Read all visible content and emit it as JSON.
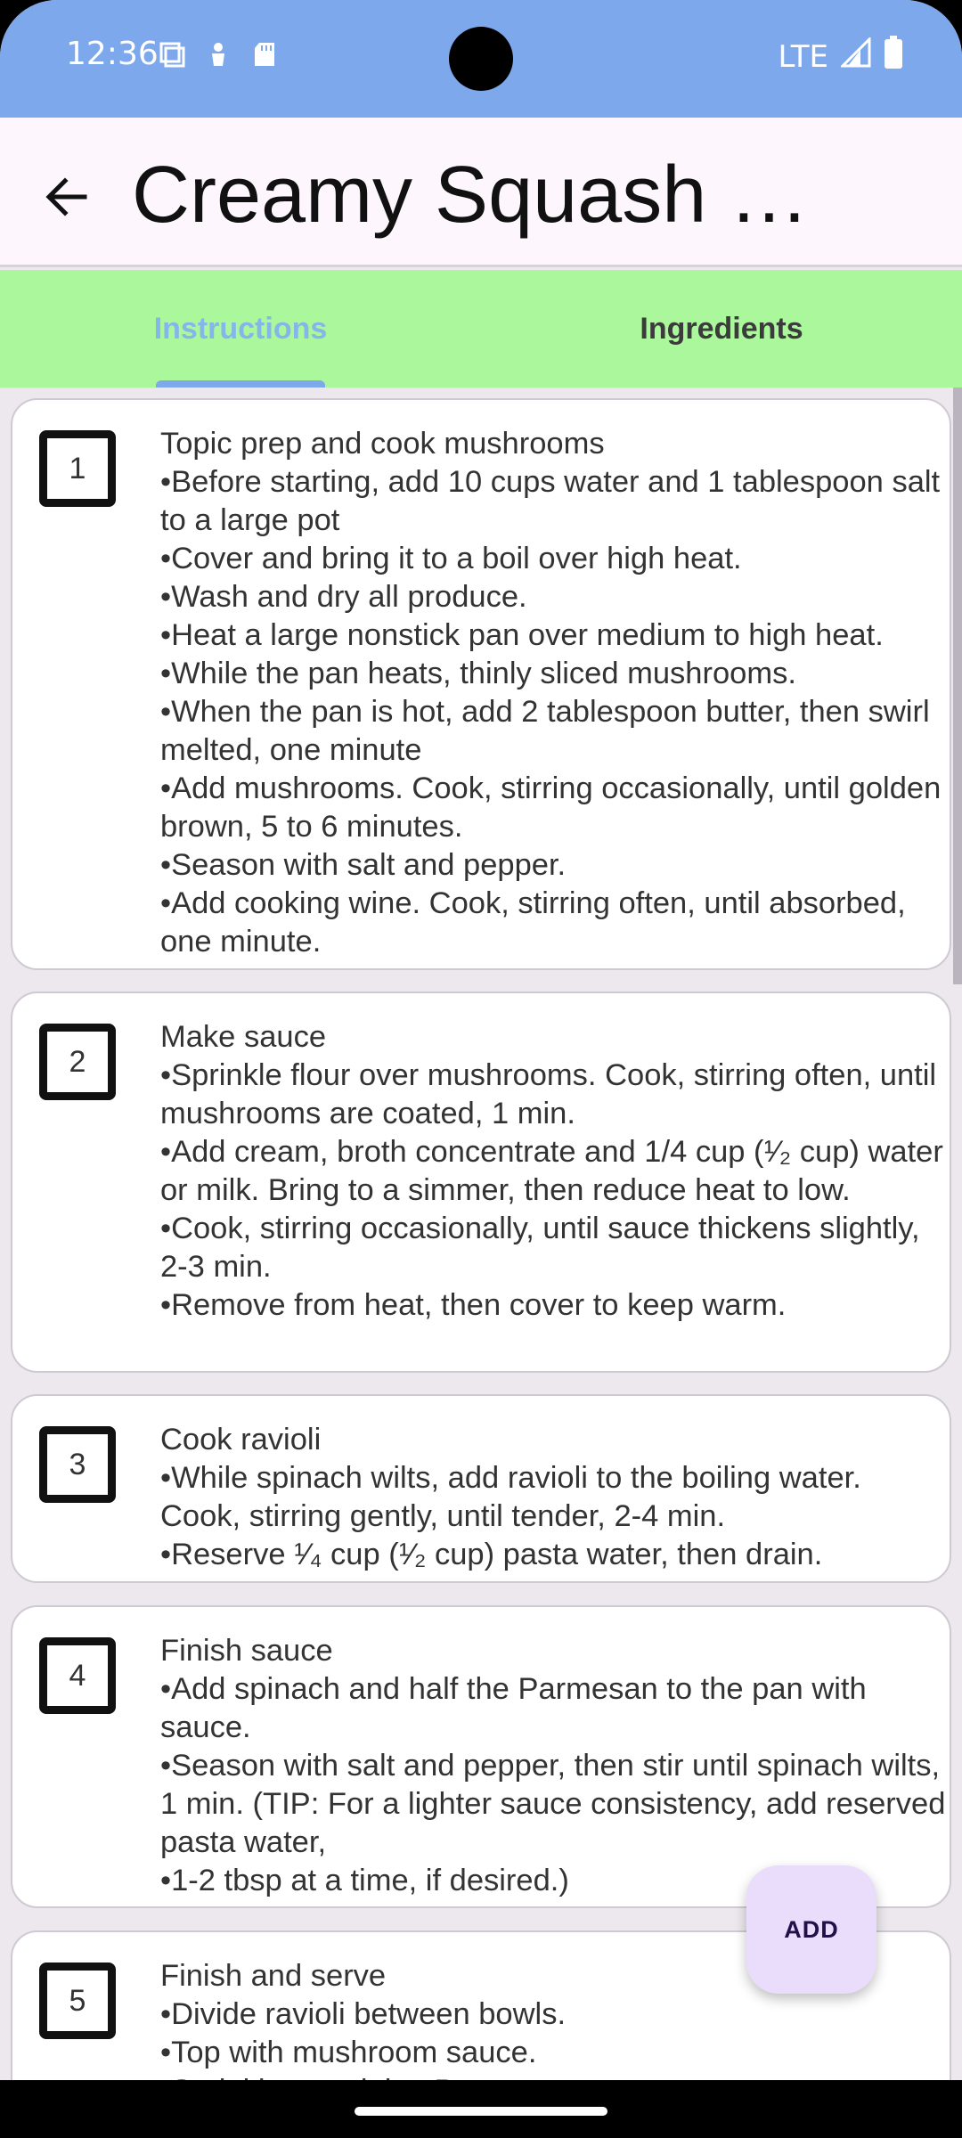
{
  "status_bar": {
    "time": "12:36",
    "network": "LTE",
    "icons": [
      "screenshot-icon",
      "person-icon",
      "sd-card-icon",
      "signal-icon",
      "battery-icon"
    ]
  },
  "app_bar": {
    "title": "Creamy Squash R…",
    "back_icon": "arrow-back-icon"
  },
  "tabs": [
    {
      "label": "Instructions",
      "selected": true
    },
    {
      "label": "Ingredients",
      "selected": false
    }
  ],
  "steps": [
    {
      "number": "1",
      "text": "Topic prep and cook mushrooms\n•Before starting, add 10 cups water and 1 tablespoon salt to a large pot\n•Cover and bring it to a boil over high heat.\n•Wash and dry all produce.\n•Heat a large nonstick pan over medium to high heat.\n•While the pan heats, thinly sliced mushrooms.\n•When the pan is hot, add 2 tablespoon butter, then swirl melted, one minute\n•Add mushrooms. Cook, stirring occasionally, until golden brown, 5 to 6 minutes.\n•Season with salt and pepper.\n•Add cooking wine. Cook, stirring often, until absorbed, one minute."
    },
    {
      "number": "2",
      "text": "Make sauce\n•Sprinkle flour over mushrooms. Cook, stirring often, until mushrooms are coated, 1 min.\n•Add cream, broth concentrate and 1/4 cup (¹⁄₂ cup) water or milk. Bring to a simmer, then reduce heat to low.\n•Cook, stirring occasionally, until sauce thickens slightly, 2-3 min.\n•Remove from heat, then cover to keep warm."
    },
    {
      "number": "3",
      "text": "Cook ravioli\n•While spinach wilts, add ravioli to the boiling water. Cook, stirring gently, until tender, 2-4 min.\n•Reserve ¹⁄₄ cup (¹⁄₂ cup) pasta water, then drain."
    },
    {
      "number": "4",
      "text": "Finish sauce\n•Add spinach and half the Parmesan to the pan with sauce.\n•Season with salt and pepper, then stir until spinach wilts, 1 min. (TIP: For a lighter sauce consistency, add reserved pasta water,\n•1-2 tbsp at a time, if desired.)"
    },
    {
      "number": "5",
      "text": "Finish and serve\n•Divide ravioli between bowls.\n•Top with mushroom sauce.\n•Sprinkle remaining Parmesan"
    }
  ],
  "fab": {
    "label": "ADD"
  },
  "colors": {
    "status_bar": "#7ea8ec",
    "tabs_bg": "#abf79b",
    "tab_selected": "#86b5ea",
    "fab_bg": "#eadcfb"
  }
}
